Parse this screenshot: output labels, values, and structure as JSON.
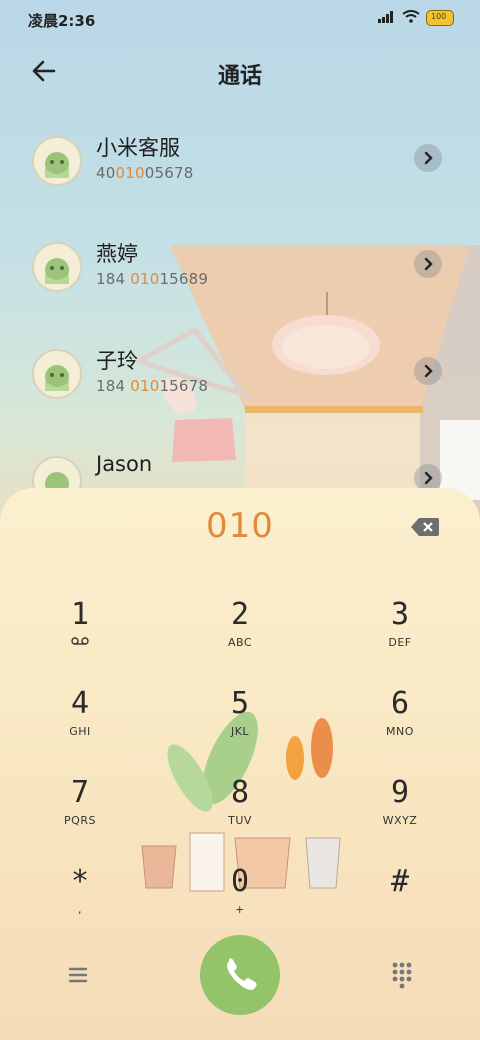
{
  "status_bar": {
    "time": "凌晨2:36",
    "battery_text": "100"
  },
  "header": {
    "title": "通话",
    "back_icon": "arrow-left-icon"
  },
  "contacts": [
    {
      "name": "小米客服",
      "number_pre": "40",
      "number_hl": "010",
      "number_post": "05678"
    },
    {
      "name": "燕婷",
      "number_pre": "184 ",
      "number_hl": "010",
      "number_post": "15689"
    },
    {
      "name": "子玲",
      "number_pre": "184 ",
      "number_hl": "010",
      "number_post": "15678"
    },
    {
      "name": "Jason",
      "number_pre": "",
      "number_hl": "",
      "number_post": ""
    }
  ],
  "dialer": {
    "input": "010",
    "keys": [
      {
        "digit": "1",
        "letters": ""
      },
      {
        "digit": "2",
        "letters": "ABC"
      },
      {
        "digit": "3",
        "letters": "DEF"
      },
      {
        "digit": "4",
        "letters": "GHI"
      },
      {
        "digit": "5",
        "letters": "JKL"
      },
      {
        "digit": "6",
        "letters": "MNO"
      },
      {
        "digit": "7",
        "letters": "PQRS"
      },
      {
        "digit": "8",
        "letters": "TUV"
      },
      {
        "digit": "9",
        "letters": "WXYZ"
      },
      {
        "digit": "*",
        "letters": ","
      },
      {
        "digit": "0",
        "letters": "+"
      },
      {
        "digit": "#",
        "letters": ""
      }
    ]
  },
  "colors": {
    "accent": "#e08a3a",
    "call_button": "#93c46a"
  }
}
